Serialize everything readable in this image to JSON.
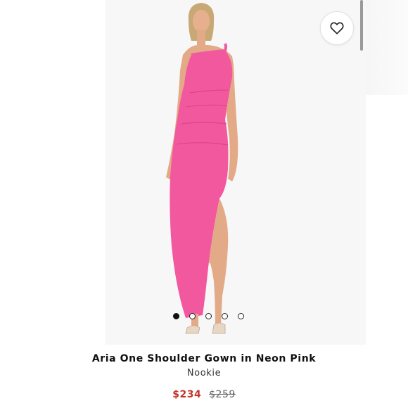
{
  "product": {
    "title": "Aria One Shoulder Gown in Neon Pink",
    "brand": "Nookie",
    "price_sale": "$234",
    "price_original": "$259"
  },
  "gallery": {
    "image_count": 5,
    "active_index": 0,
    "dress_color": "#f2589e",
    "favorite_icon": "heart-outline-icon"
  },
  "colors": {
    "sale_price": "#c2332b",
    "text": "#111111"
  }
}
